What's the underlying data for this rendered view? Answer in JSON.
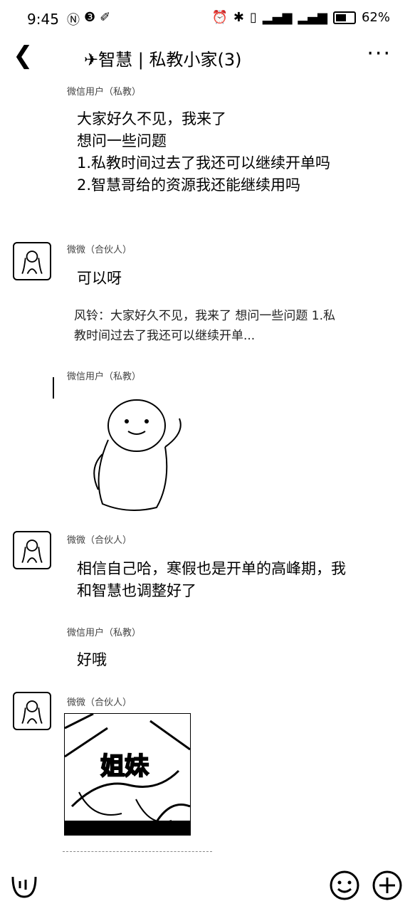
{
  "status": {
    "time": "9:45",
    "battery": "62%"
  },
  "header": {
    "title": "✈智慧 | 私教小家(3)"
  },
  "messages": [
    {
      "sender": "微信用户（私教）",
      "text": "大家好久不见，我来了\n想问一些问题\n1.私教时间过去了我还可以继续开单吗\n2.智慧哥给的资源我还能继续用吗"
    },
    {
      "sender": "微微（合伙人）",
      "text": "可以呀"
    },
    {
      "quote": "风铃：大家好久不见，我来了 想问一些问题 1.私教时间过去了我还可以继续开单..."
    },
    {
      "sender": "微信用户（私教）"
    },
    {
      "sender": "微微（合伙人）",
      "text": "相信自己哈，寒假也是开单的高峰期，我和智慧也调整好了"
    },
    {
      "sender": "微信用户（私教）",
      "text": "好哦"
    },
    {
      "sender": "微微（合伙人）",
      "sticker_text": "姐妹"
    }
  ]
}
